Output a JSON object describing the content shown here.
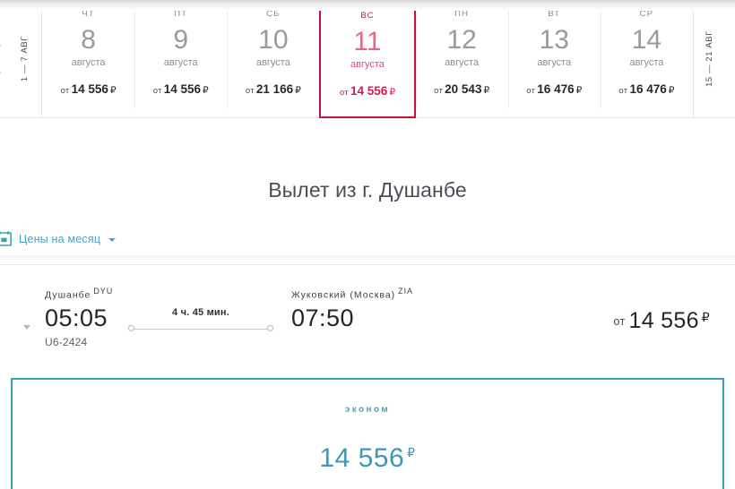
{
  "calendar": {
    "prev_nav": {
      "label": "1 — 7 АВГ",
      "icon": "chevron-left-icon"
    },
    "next_nav": {
      "label": "15 — 21 АВГ",
      "icon": "chevron-right-icon"
    },
    "price_prefix": "от",
    "currency": "₽",
    "days": [
      {
        "dow": "чт",
        "num": "8",
        "month": "августа",
        "price": "14 556",
        "selected": false
      },
      {
        "dow": "пт",
        "num": "9",
        "month": "августа",
        "price": "14 556",
        "selected": false
      },
      {
        "dow": "сб",
        "num": "10",
        "month": "августа",
        "price": "21 166",
        "selected": false
      },
      {
        "dow": "вс",
        "num": "11",
        "month": "августа",
        "price": "14 556",
        "selected": true
      },
      {
        "dow": "пн",
        "num": "12",
        "month": "августа",
        "price": "20 543",
        "selected": false
      },
      {
        "dow": "вт",
        "num": "13",
        "month": "августа",
        "price": "16 476",
        "selected": false
      },
      {
        "dow": "ср",
        "num": "14",
        "month": "августа",
        "price": "16 476",
        "selected": false
      }
    ]
  },
  "page": {
    "title": "Вылет из г. Душанбе",
    "month_prices_label": "Цены на месяц"
  },
  "flight": {
    "departure": {
      "city": "Душанбе",
      "iata": "DYU",
      "time": "05:05",
      "flight_number": "U6-2424"
    },
    "arrival": {
      "city": "Жуковский (Москва)",
      "iata": "ZIA",
      "time": "07:50"
    },
    "duration": "4 ч. 45 мин.",
    "price": {
      "prefix": "от",
      "amount": "14 556",
      "currency": "₽"
    }
  },
  "fare": {
    "class": "эконом",
    "amount": "14 556",
    "currency": "₽"
  },
  "colors": {
    "accent_teal": "#3f9fba",
    "selected_red": "#c8103c",
    "price_red": "#d5194d",
    "link_blue": "#4a9fc0"
  }
}
